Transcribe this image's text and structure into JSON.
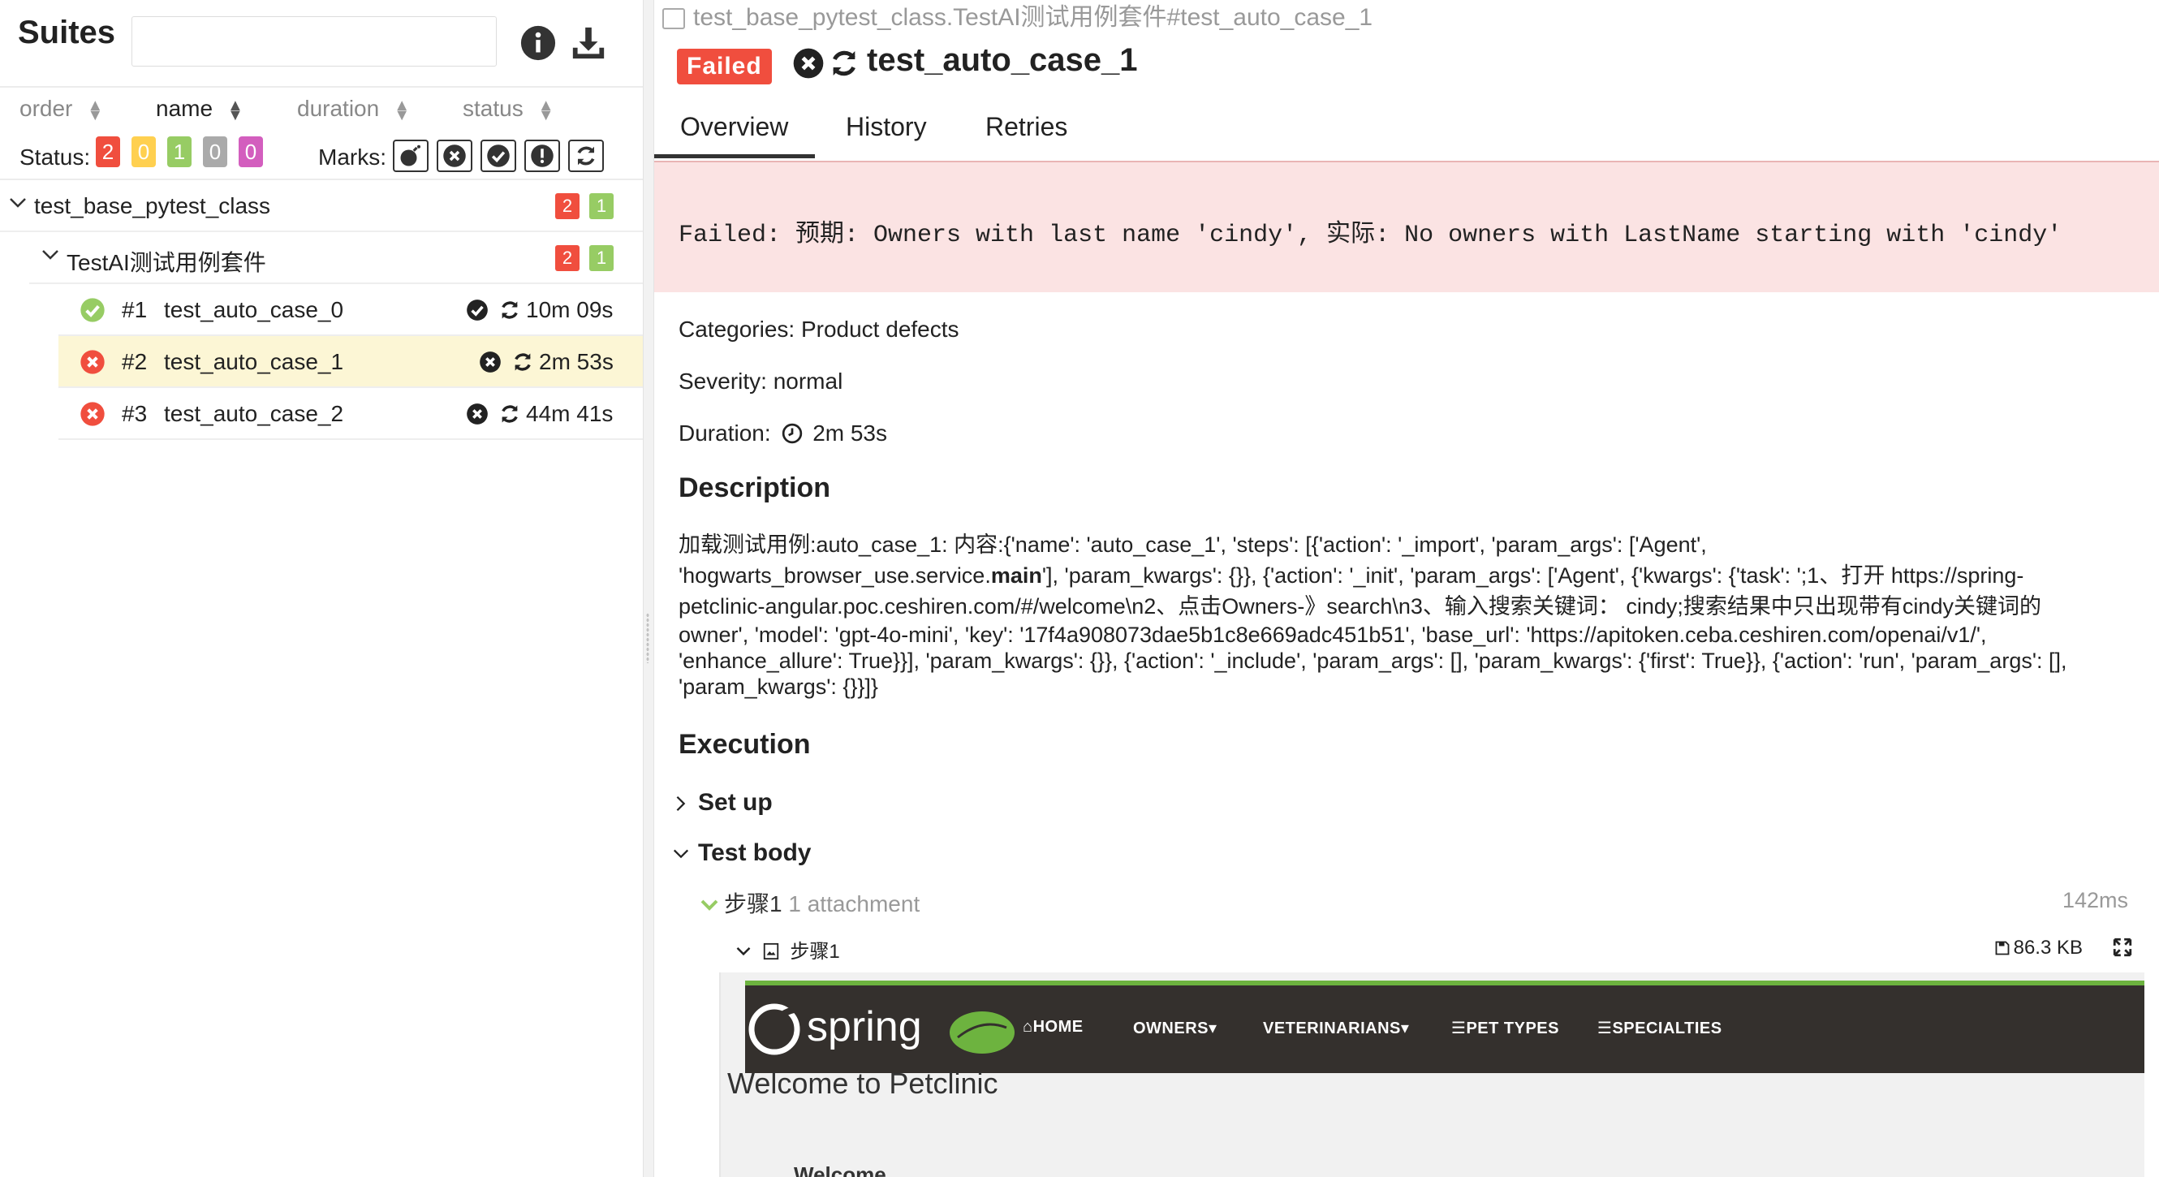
{
  "left": {
    "title": "Suites",
    "search_placeholder": "",
    "sort": [
      {
        "label": "order"
      },
      {
        "label": "name"
      },
      {
        "label": "duration"
      },
      {
        "label": "status"
      }
    ],
    "status_label": "Status:",
    "status_counts": [
      {
        "value": "2",
        "color": "#f04e3e"
      },
      {
        "value": "0",
        "color": "#ffd050"
      },
      {
        "value": "1",
        "color": "#97cc64"
      },
      {
        "value": "0",
        "color": "#aaaaaa"
      },
      {
        "value": "0",
        "color": "#d35ebe"
      }
    ],
    "marks_label": "Marks:",
    "tree": {
      "suite": {
        "name": "test_base_pytest_class",
        "failed": "2",
        "passed": "1"
      },
      "subsuite": {
        "name": "TestAI测试用例套件",
        "failed": "2",
        "passed": "1"
      },
      "cases": [
        {
          "num": "#1",
          "name": "test_auto_case_0",
          "duration": "10m 09s",
          "status": "passed"
        },
        {
          "num": "#2",
          "name": "test_auto_case_1",
          "duration": "2m 53s",
          "status": "failed"
        },
        {
          "num": "#3",
          "name": "test_auto_case_2",
          "duration": "44m 41s",
          "status": "failed"
        }
      ]
    }
  },
  "right": {
    "breadcrumb": "test_base_pytest_class.TestAI测试用例套件#test_auto_case_1",
    "status_tag": "Failed",
    "title": "test_auto_case_1",
    "tabs": [
      "Overview",
      "History",
      "Retries"
    ],
    "error_message": "Failed: 预期: Owners with last name 'cindy', 实际: No owners with LastName starting with 'cindy'",
    "categories": "Categories: Product defects",
    "severity": "Severity: normal",
    "duration_label": "Duration:",
    "duration_value": "2m 53s",
    "description_title": "Description",
    "description_lines": [
      "加载测试用例:auto_case_1: 内容:{'name': 'auto_case_1', 'steps': [{'action': '_import', 'param_args': ['Agent',",
      "'hogwarts_browser_use.service.",
      "main",
      "'], 'param_kwargs': {}}, {'action': '_init', 'param_args': ['Agent', {'kwargs': {'task': ';1、打开 https://spring-",
      "petclinic-angular.poc.ceshiren.com/#/welcome\\n2、点击Owners-》search\\n3、输入搜索关键词： cindy;搜索结果中只出现带有cindy关键词的",
      "owner', 'model': 'gpt-4o-mini', 'key': '17f4a908073dae5b1c8e669adc451b51', 'base_url': 'https://apitoken.ceba.ceshiren.com/openai/v1/',",
      "'enhance_allure': True}}], 'param_kwargs': {}}, {'action': '_include', 'param_args': [], 'param_kwargs': {'first': True}}, {'action': 'run', 'param_args': [],",
      "'param_kwargs': {}}]}"
    ],
    "execution_title": "Execution",
    "setup_label": "Set up",
    "testbody_label": "Test body",
    "step_name": "步骤1",
    "step_attachments": "1 attachment",
    "step_time": "142ms",
    "attachment_name": "步骤1",
    "attachment_size": "86.3 KB",
    "preview": {
      "logo_text": "spring",
      "nav": [
        "HOME",
        "OWNERS",
        "VETERINARIANS",
        "PET TYPES",
        "SPECIALTIES"
      ],
      "welcome": "Welcome to Petclinic",
      "welcome_sub": "Welcome"
    }
  }
}
